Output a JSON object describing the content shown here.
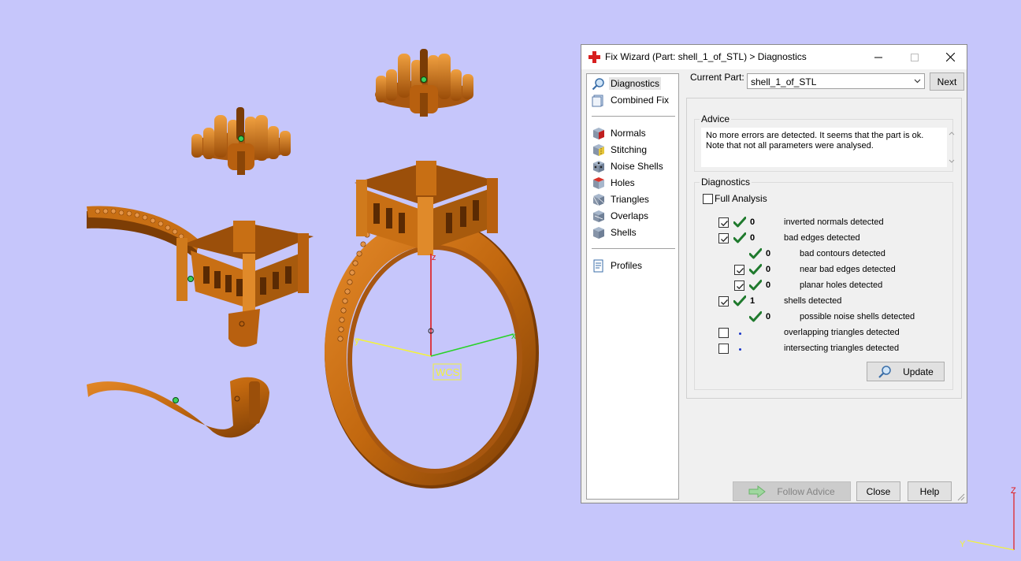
{
  "viewport": {
    "wcs_label": "WCS",
    "axis_labels": {
      "x": "x",
      "y": "y",
      "z": "z"
    },
    "corner_axis_labels": {
      "z": "Z",
      "y": "Y"
    }
  },
  "dialog": {
    "title": "Fix Wizard (Part: shell_1_of_STL) > Diagnostics",
    "window_controls": {
      "minimize": "—",
      "maximize": "☐",
      "close": "✕"
    },
    "sidebar": {
      "group1": [
        {
          "label": "Diagnostics",
          "icon": "magnifier-icon",
          "selected": true
        },
        {
          "label": "Combined Fix",
          "icon": "combined-fix-icon"
        }
      ],
      "group2": [
        {
          "label": "Normals",
          "icon": "normals-icon"
        },
        {
          "label": "Stitching",
          "icon": "stitching-icon"
        },
        {
          "label": "Noise Shells",
          "icon": "noise-shells-icon"
        },
        {
          "label": "Holes",
          "icon": "holes-icon"
        },
        {
          "label": "Triangles",
          "icon": "triangles-icon"
        },
        {
          "label": "Overlaps",
          "icon": "overlaps-icon"
        },
        {
          "label": "Shells",
          "icon": "shells-icon"
        }
      ],
      "group3": [
        {
          "label": "Profiles",
          "icon": "profiles-icon"
        }
      ]
    },
    "current_part": {
      "label": "Current Part:",
      "value": "shell_1_of_STL"
    },
    "next_label": "Next",
    "advice": {
      "title": "Advice",
      "line1": "No more errors are detected. It seems that the part is ok.",
      "line2": "Note that not all parameters were analysed."
    },
    "diagnostics": {
      "title": "Diagnostics",
      "full_analysis_label": "Full Analysis",
      "full_analysis_checked": false,
      "rows": [
        {
          "checkbox": true,
          "checked": true,
          "status": "ok",
          "count": "0",
          "description": "inverted normals detected",
          "indent": 0
        },
        {
          "checkbox": true,
          "checked": true,
          "status": "ok",
          "count": "0",
          "description": "bad edges detected",
          "indent": 0
        },
        {
          "checkbox": false,
          "checked": false,
          "status": "ok",
          "count": "0",
          "description": "bad contours detected",
          "indent": 1
        },
        {
          "checkbox": true,
          "checked": true,
          "status": "ok",
          "count": "0",
          "description": "near bad edges detected",
          "indent": 1
        },
        {
          "checkbox": true,
          "checked": true,
          "status": "ok",
          "count": "0",
          "description": "planar holes detected",
          "indent": 1
        },
        {
          "checkbox": true,
          "checked": true,
          "status": "ok",
          "count": "1",
          "description": "shells detected",
          "indent": 0
        },
        {
          "checkbox": false,
          "checked": false,
          "status": "ok",
          "count": "0",
          "description": "possible noise shells detected",
          "indent": 1
        },
        {
          "checkbox": true,
          "checked": false,
          "status": "pending",
          "count": "",
          "description": "overlapping triangles detected",
          "indent": 0
        },
        {
          "checkbox": true,
          "checked": false,
          "status": "pending",
          "count": "",
          "description": "intersecting triangles detected",
          "indent": 0
        }
      ]
    },
    "update_label": "Update",
    "follow_advice_label": "Follow Advice",
    "close_label": "Close",
    "help_label": "Help",
    "colors": {
      "background": "#c6c6fb",
      "ring_copper": "#c86f14",
      "tick_green": "#1f7a2d",
      "pending_dot": "#1a36c8"
    }
  }
}
